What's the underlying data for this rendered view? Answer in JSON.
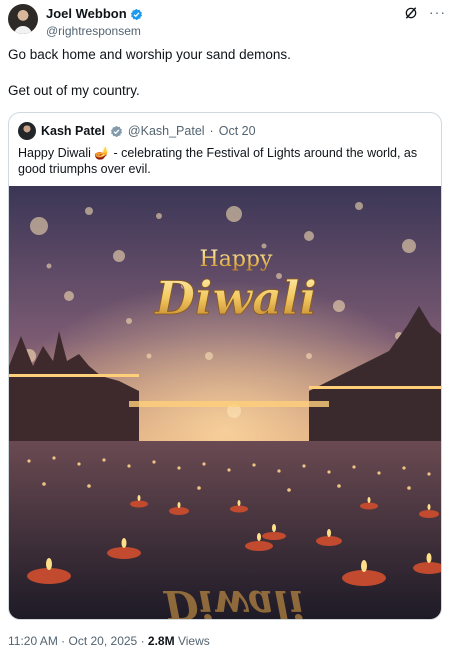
{
  "post": {
    "author_name": "Joel Webbon",
    "author_handle": "@rightresponsem",
    "text_lines": [
      "Go back home and worship your sand demons.",
      "Get out of my country."
    ],
    "more_label": "···"
  },
  "quoted": {
    "author_name": "Kash Patel",
    "author_handle": "@Kash_Patel",
    "separator": "·",
    "date": "Oct 20",
    "text": "Happy Diwali 🪔 - celebrating the Festival of Lights around the world, as good triumphs over evil.",
    "image": {
      "title_line1": "Happy",
      "title_line2": "Diwali",
      "reflection_text": "Diwali"
    }
  },
  "footer": {
    "time": "11:20 AM",
    "separator": "·",
    "date": "Oct 20, 2025",
    "views_count": "2.8M",
    "views_label": "Views"
  },
  "colors": {
    "verified_blue": "#1d9bf0",
    "verified_gray": "#829aab",
    "muted_text": "#536471",
    "border": "#cfd9de"
  }
}
